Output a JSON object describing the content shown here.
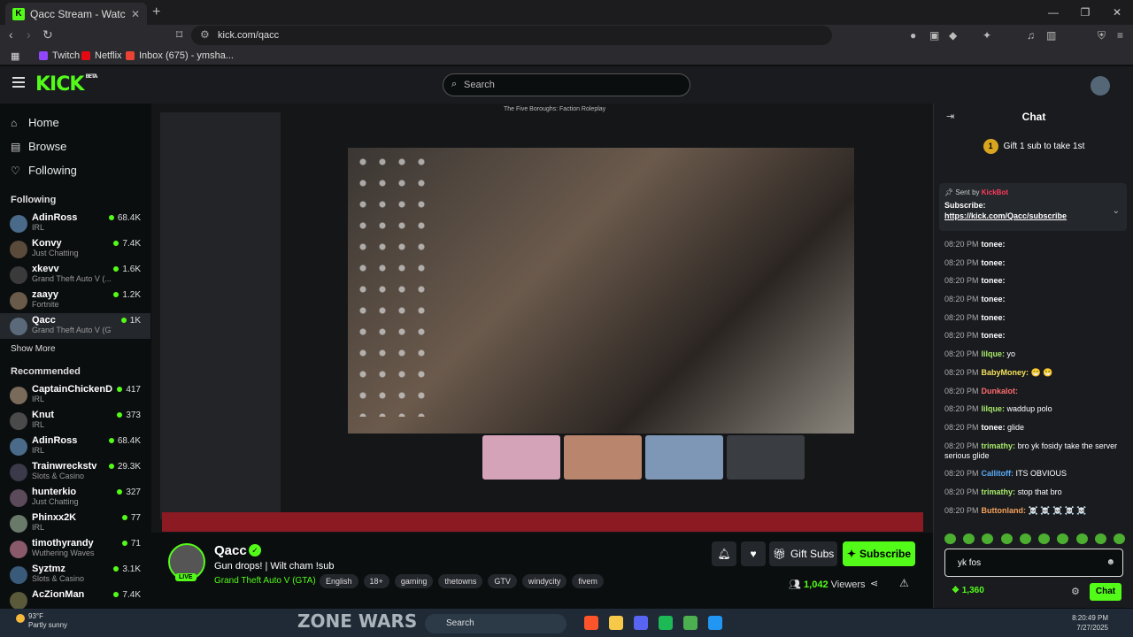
{
  "browser": {
    "tab_title": "Qacc Stream - Watch Live on",
    "url": "kick.com/qacc",
    "bookmarks": [
      {
        "label": "Twitch",
        "color": "#9146ff"
      },
      {
        "label": "Netflix",
        "color": "#e50914"
      },
      {
        "label": "Inbox (675) - ymsha...",
        "color": "#ea4335"
      }
    ]
  },
  "header": {
    "logo": "KICK",
    "logo_badge": "BETA",
    "search_placeholder": "Search"
  },
  "sidebar": {
    "nav": [
      {
        "label": "Home",
        "icon": "home-icon",
        "glyph": "⌂"
      },
      {
        "label": "Browse",
        "icon": "browse-icon",
        "glyph": "▤"
      },
      {
        "label": "Following",
        "icon": "heart-icon",
        "glyph": "♡"
      }
    ],
    "following_title": "Following",
    "following": [
      {
        "name": "AdinRoss",
        "category": "IRL",
        "viewers": "68.4K"
      },
      {
        "name": "Konvy",
        "category": "Just Chatting",
        "viewers": "7.4K"
      },
      {
        "name": "xkevv",
        "category": "Grand Theft Auto V (...",
        "viewers": "1.6K"
      },
      {
        "name": "zaayy",
        "category": "Fortnite",
        "viewers": "1.2K"
      },
      {
        "name": "Qacc",
        "category": "Grand Theft Auto V (GTA)",
        "viewers": "1K"
      }
    ],
    "show_more": "Show More",
    "recommended_title": "Recommended",
    "recommended": [
      {
        "name": "CaptainChickenD",
        "category": "IRL",
        "viewers": "417"
      },
      {
        "name": "Knut",
        "category": "IRL",
        "viewers": "373"
      },
      {
        "name": "AdinRoss",
        "category": "IRL",
        "viewers": "68.4K"
      },
      {
        "name": "Trainwreckstv",
        "category": "Slots & Casino",
        "viewers": "29.3K"
      },
      {
        "name": "hunterkio",
        "category": "Just Chatting",
        "viewers": "327"
      },
      {
        "name": "Phinxx2K",
        "category": "IRL",
        "viewers": "77"
      },
      {
        "name": "timothyrandy",
        "category": "Wuthering Waves",
        "viewers": "71"
      },
      {
        "name": "Syztmz",
        "category": "Slots & Casino",
        "viewers": "3.1K"
      },
      {
        "name": "AcZionMan",
        "category": "",
        "viewers": "7.4K"
      }
    ]
  },
  "video": {
    "window_title": "The Five Boroughs: Faction Roleplay"
  },
  "stream": {
    "name": "Qacc",
    "title": "Gun drops! | Wilt cham !sub",
    "category": "Grand Theft Auto V (GTA)",
    "live_label": "LIVE",
    "tags": [
      "English",
      "18+",
      "gaming",
      "thetowns",
      "GTV",
      "windycity",
      "fivem"
    ],
    "gift_subs_label": "Gift Subs",
    "subscribe_label": "Subscribe",
    "viewers": "1,042",
    "viewers_label": "Viewers"
  },
  "chat": {
    "title": "Chat",
    "gift_count": "1",
    "gift_text": "Gift 1 sub to take 1st",
    "pinned": {
      "sent_by": "Sent by",
      "sender": "KickBot",
      "subscribe_label": "Subscribe:",
      "link": "https://kick.com/Qacc/subscribe"
    },
    "messages": [
      {
        "time": "08:20 PM",
        "user": "tonee:",
        "color": "#ffffff",
        "text": ""
      },
      {
        "time": "08:20 PM",
        "user": "tonee:",
        "color": "#ffffff",
        "text": ""
      },
      {
        "time": "08:20 PM",
        "user": "tonee:",
        "color": "#ffffff",
        "text": ""
      },
      {
        "time": "08:20 PM",
        "user": "tonee:",
        "color": "#ffffff",
        "text": ""
      },
      {
        "time": "08:20 PM",
        "user": "tonee:",
        "color": "#ffffff",
        "text": ""
      },
      {
        "time": "08:20 PM",
        "user": "tonee:",
        "color": "#ffffff",
        "text": ""
      },
      {
        "time": "08:20 PM",
        "user": "lilque:",
        "color": "#a8e86b",
        "text": "yo"
      },
      {
        "time": "08:20 PM",
        "user": "BabyMoney:",
        "color": "#f5e05a",
        "text": "😁 😁"
      },
      {
        "time": "08:20 PM",
        "user": "Dunkalot:",
        "color": "#ff6b6b",
        "text": ""
      },
      {
        "time": "08:20 PM",
        "user": "lilque:",
        "color": "#a8e86b",
        "text": "waddup polo"
      },
      {
        "time": "08:20 PM",
        "user": "tonee:",
        "color": "#ffffff",
        "text": "glide"
      },
      {
        "time": "08:20 PM",
        "user": "trimathy:",
        "color": "#a8e86b",
        "text": "bro yk fosidy take the server serious glide"
      },
      {
        "time": "08:20 PM",
        "user": "Callitoff:",
        "color": "#5aa9f5",
        "text": "ITS OBVIOUS"
      },
      {
        "time": "08:20 PM",
        "user": "trimathy:",
        "color": "#a8e86b",
        "text": "stop that bro"
      },
      {
        "time": "08:20 PM",
        "user": "Buttonland:",
        "color": "#f5a25a",
        "text": "☠️ ☠️ ☠️ ☠️ ☠️"
      }
    ],
    "input_value": "yk fos",
    "points": "1,360",
    "send_label": "Chat"
  },
  "os": {
    "weather_temp": "93°F",
    "weather_desc": "Partly sunny",
    "search_label": "Search",
    "overlay_text": "ZONE WARS",
    "time": "8:20:49 PM",
    "date": "7/27/2025"
  }
}
